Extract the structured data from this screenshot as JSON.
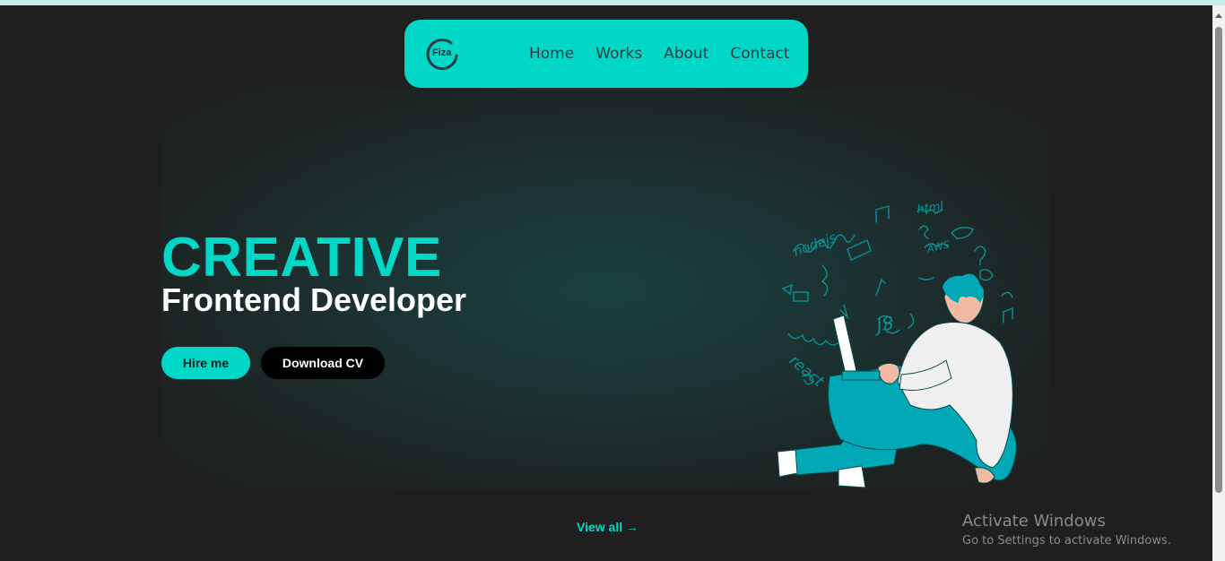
{
  "brand": {
    "logo_text": "Fiza"
  },
  "nav": {
    "items": [
      {
        "label": "Home"
      },
      {
        "label": "Works"
      },
      {
        "label": "About"
      },
      {
        "label": "Contact"
      }
    ]
  },
  "hero": {
    "headline": "CREATIVE",
    "subheadline": "Frontend Developer",
    "hire_label": "Hire me",
    "cv_label": "Download CV",
    "illustration_doodles": [
      "html",
      "nodejs",
      "AWS",
      "JS",
      "react",
      "Git"
    ]
  },
  "works": {
    "view_all_label": "View all →"
  },
  "os_overlay": {
    "activate_title": "Activate Windows",
    "activate_subtitle": "Go to Settings to activate Windows."
  },
  "colors": {
    "accent": "#00d7c6",
    "background": "#1f1f1f",
    "hero_glow": "#19403f",
    "doodle": "#0c8f92",
    "figure_teal": "#00a9b5",
    "skin": "#f2b9a3"
  }
}
